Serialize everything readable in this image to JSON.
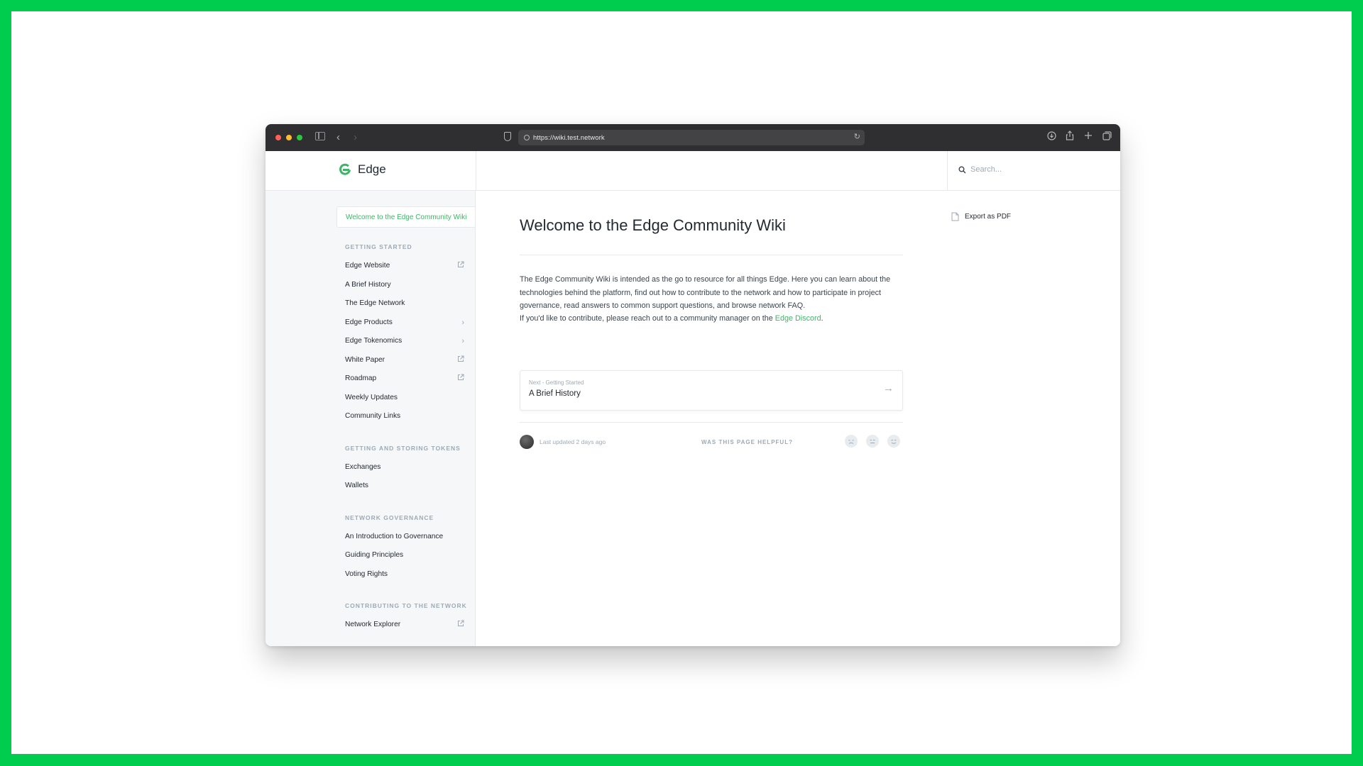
{
  "browser": {
    "url": "https://wiki.test.network"
  },
  "header": {
    "brand": "Edge",
    "search_placeholder": "Search..."
  },
  "sidebar": {
    "active_item": "Welcome to the Edge Community Wiki",
    "sections": [
      {
        "title": "GETTING STARTED",
        "items": [
          {
            "label": "Edge Website",
            "trail": "external"
          },
          {
            "label": "A Brief History",
            "trail": ""
          },
          {
            "label": "The Edge Network",
            "trail": ""
          },
          {
            "label": "Edge Products",
            "trail": "chevron"
          },
          {
            "label": "Edge Tokenomics",
            "trail": "chevron"
          },
          {
            "label": "White Paper",
            "trail": "external"
          },
          {
            "label": "Roadmap",
            "trail": "external"
          },
          {
            "label": "Weekly Updates",
            "trail": ""
          },
          {
            "label": "Community Links",
            "trail": ""
          }
        ]
      },
      {
        "title": "GETTING AND STORING TOKENS",
        "items": [
          {
            "label": "Exchanges",
            "trail": ""
          },
          {
            "label": "Wallets",
            "trail": ""
          }
        ]
      },
      {
        "title": "NETWORK GOVERNANCE",
        "items": [
          {
            "label": "An Introduction to Governance",
            "trail": ""
          },
          {
            "label": "Guiding Principles",
            "trail": ""
          },
          {
            "label": "Voting Rights",
            "trail": ""
          }
        ]
      },
      {
        "title": "CONTRIBUTING TO THE NETWORK",
        "items": [
          {
            "label": "Network Explorer",
            "trail": "external"
          }
        ]
      }
    ]
  },
  "main": {
    "title": "Welcome to the Edge Community Wiki",
    "paragraph1": "The Edge Community Wiki is intended as the go to resource for all things Edge. Here you can learn about the technologies behind the platform, find out how to contribute to the network and how to participate in project governance, read answers to common support questions, and browse network FAQ.",
    "paragraph2_prefix": "If you'd like to contribute, please reach out to a community manager on the ",
    "paragraph2_link": "Edge Discord",
    "paragraph2_suffix": ".",
    "next": {
      "label": "Next - Getting Started",
      "title": "A Brief History"
    },
    "last_updated": "Last updated 2 days ago",
    "helpful_prompt": "WAS THIS PAGE HELPFUL?"
  },
  "aside": {
    "export_label": "Export as PDF"
  },
  "colors": {
    "frame": "#00cc4e",
    "accent": "#3eb566",
    "chrome": "#2f2f31"
  }
}
